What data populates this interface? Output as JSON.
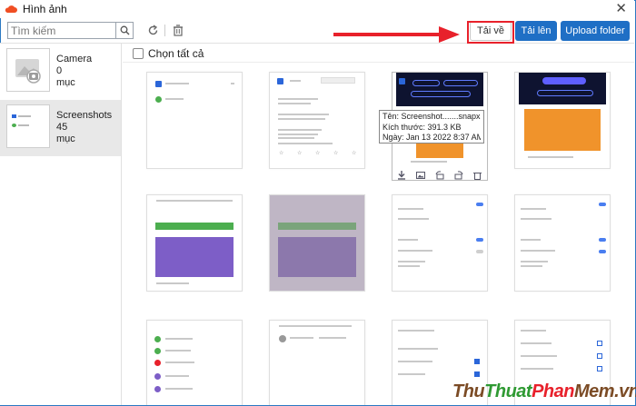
{
  "window": {
    "title": "Hình ảnh"
  },
  "toolbar": {
    "search_placeholder": "Tìm kiếm",
    "download_label": "Tải về",
    "upload_label": "Tải lên",
    "upload_folder_label": "Upload folder"
  },
  "sidebar": {
    "albums": [
      {
        "name": "Camera",
        "count": "0",
        "unit": "mục"
      },
      {
        "name": "Screenshots",
        "count": "45",
        "unit": "mục"
      }
    ]
  },
  "main": {
    "select_all_label": "Chọn tất cả"
  },
  "tooltip": {
    "name": "Tên: Screenshot.......snapx.jpg",
    "size": "Kích thước: 391.3 KB",
    "date": "Ngày: Jan 13 2022 8:37 AM"
  },
  "watermark": {
    "part_a": "Thu",
    "part_b": "Thuat",
    "part_c": "Phan",
    "part_d": "Mem",
    "suffix": ".vn"
  },
  "colors": {
    "accent": "#1f6fc5",
    "highlight": "#e8212b",
    "border": "#2b79c2"
  }
}
